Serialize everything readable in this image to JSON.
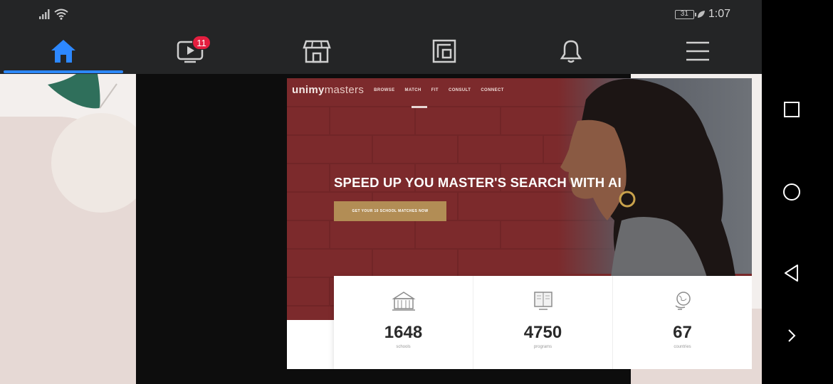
{
  "status": {
    "battery": "31",
    "time": "1:07"
  },
  "tabs": [
    {
      "name": "home",
      "icon": "home-icon",
      "active": true
    },
    {
      "name": "watch",
      "icon": "video-icon",
      "badge": "11"
    },
    {
      "name": "marketplace",
      "icon": "store-icon"
    },
    {
      "name": "gaming",
      "icon": "gaming-icon"
    },
    {
      "name": "notifications",
      "icon": "bell-icon"
    },
    {
      "name": "menu",
      "icon": "menu-icon"
    }
  ],
  "site": {
    "logo_bold": "unimy",
    "logo_light": "masters",
    "nav": [
      "BROWSE",
      "MATCH",
      "FIT",
      "CONSULT",
      "CONNECT"
    ],
    "headline": "SPEED UP YOU MASTER'S SEARCH WITH AI",
    "cta": "GET YOUR 10 SCHOOL MATCHES NOW",
    "stats": [
      {
        "value": "1648",
        "label": "schools",
        "icon": "school-building-icon"
      },
      {
        "value": "4750",
        "label": "programs",
        "icon": "open-book-icon"
      },
      {
        "value": "67",
        "label": "countries",
        "icon": "globe-icon"
      }
    ]
  },
  "android_nav": [
    "square-recents-icon",
    "circle-home-icon",
    "triangle-back-icon",
    "chevron-right-icon"
  ],
  "colors": {
    "accent": "#2d88ff",
    "badge": "#e41e3f",
    "hero": "#7c2a2c",
    "cta": "#b28d55"
  }
}
